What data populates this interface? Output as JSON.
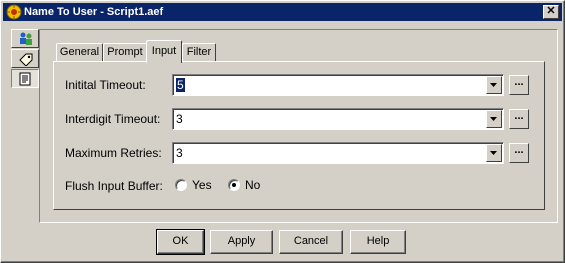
{
  "window": {
    "title": "Name To User - Script1.aef",
    "close_glyph": "✕"
  },
  "toolbar": [
    {
      "icon": "users-icon",
      "state": "raised"
    },
    {
      "icon": "tag-icon",
      "state": "raised"
    },
    {
      "icon": "document-icon",
      "state": "sunken"
    }
  ],
  "tabs": [
    {
      "label": "General",
      "active": false
    },
    {
      "label": "Prompt",
      "active": false
    },
    {
      "label": "Input",
      "active": true
    },
    {
      "label": "Filter",
      "active": false
    }
  ],
  "form": {
    "initial_timeout": {
      "label": "Initital Timeout:",
      "value": "5"
    },
    "interdigit_timeout": {
      "label": "Interdigit Timeout:",
      "value": "3"
    },
    "maximum_retries": {
      "label": "Maximum Retries:",
      "value": "3"
    },
    "flush_input_buffer": {
      "label": "Flush Input Buffer:",
      "yes_label": "Yes",
      "no_label": "No",
      "selected": "No"
    },
    "ellipsis": "..."
  },
  "buttons": {
    "ok": "OK",
    "apply": "Apply",
    "cancel": "Cancel",
    "help": "Help"
  },
  "colors": {
    "face": "#d4d0c8",
    "title_bar": "#0a246a",
    "selection": "#0a246a"
  }
}
